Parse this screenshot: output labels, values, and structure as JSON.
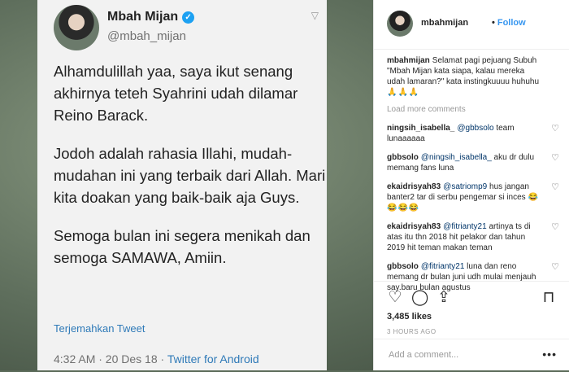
{
  "tweet": {
    "name": "Mbah Mijan",
    "handle": "@mbah_mijan",
    "paragraphs": [
      "Alhamdulillah yaa, saya ikut senang akhirnya teteh Syahrini udah dilamar Reino Barack.",
      "Jodoh adalah rahasia Illahi, mudah-mudahan ini yang terbaik dari Allah. Mari kita doakan yang baik-baik aja Guys.",
      "Semoga bulan ini segera menikah dan semoga SAMAWA, Amiin."
    ],
    "translate_label": "Terjemahkan Tweet",
    "timestamp": "4:32 AM · 20 Des 18 ·",
    "source": "Twitter for Android"
  },
  "instagram": {
    "username": "mbahmijan",
    "follow_label": "Follow",
    "caption": {
      "user": "mbahmijan",
      "text": "Selamat pagi pejuang Subuh \"Mbah Mijan kata siapa, kalau mereka udah lamaran?\" kata instingkuuuu huhuhu",
      "emoji": "🙏🙏🙏"
    },
    "load_more": "Load more comments",
    "comments": [
      {
        "user": "ningsih_isabella_",
        "mention": "@gbbsolo",
        "text": " team lunaaaaaa",
        "emoji": ""
      },
      {
        "user": "gbbsolo",
        "mention": "@ningsih_isabella_",
        "text": " aku dr dulu memang fans luna",
        "emoji": ""
      },
      {
        "user": "ekaidrisyah83",
        "mention": "@satriomp9",
        "text": " hus jangan banter2 tar di serbu pengemar si inces",
        "emoji": "😂😂😂😂"
      },
      {
        "user": "ekaidrisyah83",
        "mention": "@fitrianty21",
        "text": " artinya ts di atas itu thn 2018 hit pelakor dan tahun 2019 hit teman makan teman",
        "emoji": ""
      },
      {
        "user": "gbbsolo",
        "mention": "@fitrianty21",
        "text": " luna dan reno memang dr bulan juni udh mulai menjauh say.baru bulan agustus",
        "emoji": ""
      }
    ],
    "likes": "3,485 likes",
    "time": "3 HOURS AGO",
    "add_comment_placeholder": "Add a comment...",
    "more_label": "•••"
  }
}
